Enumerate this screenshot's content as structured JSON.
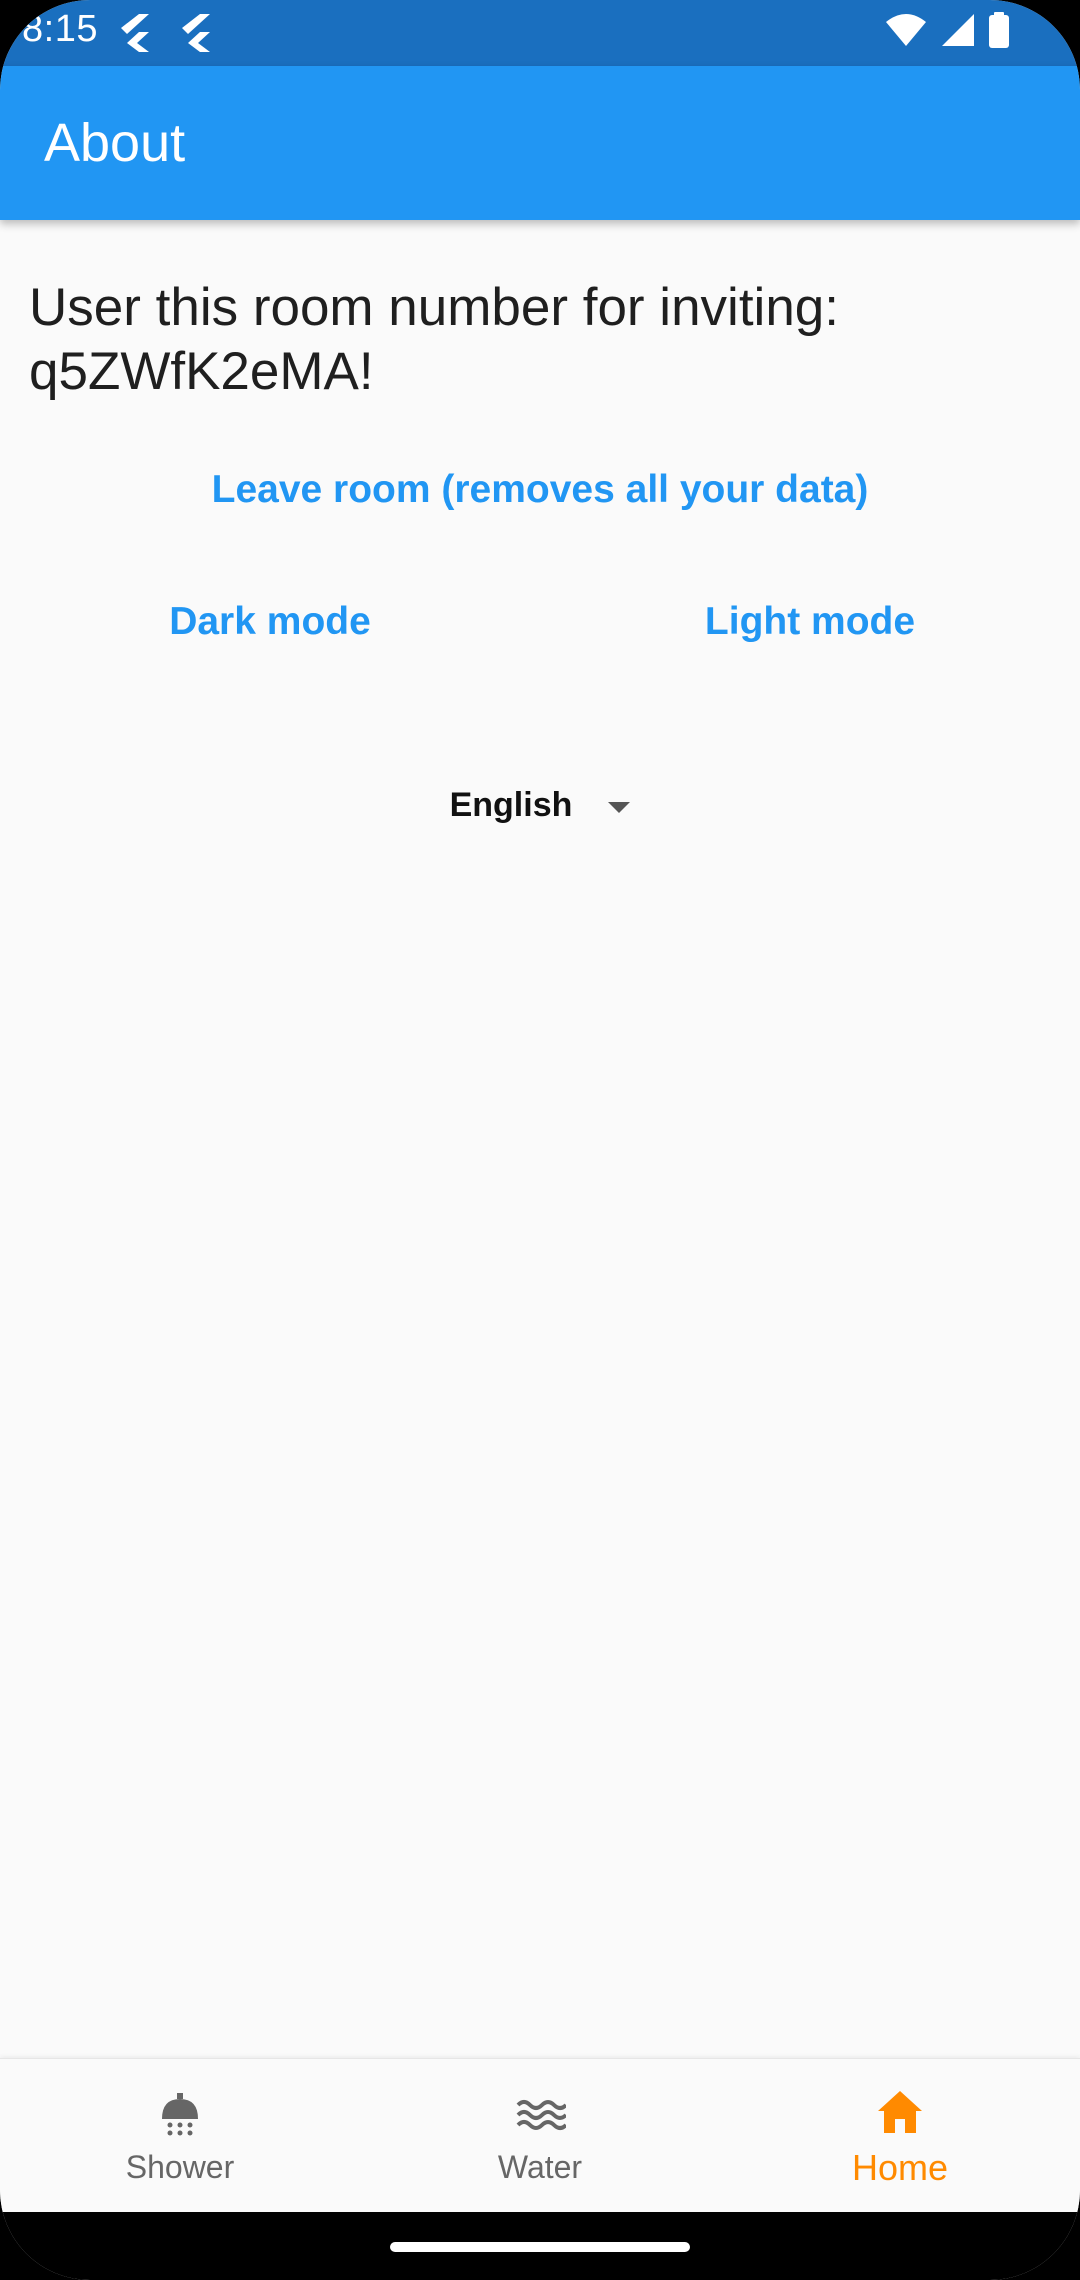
{
  "status_bar": {
    "time": "8:15"
  },
  "app_bar": {
    "title": "About"
  },
  "content": {
    "invite_line1": "User this room number for inviting:",
    "invite_line2": "q5ZWfK2eMA!",
    "leave_room_label": "Leave room (removes all your data)",
    "dark_mode_label": "Dark mode",
    "light_mode_label": "Light mode",
    "language_value": "English"
  },
  "bottom_nav": {
    "items": [
      {
        "label": "Shower",
        "icon": "shower-icon",
        "active": false
      },
      {
        "label": "Water",
        "icon": "waves-icon",
        "active": false
      },
      {
        "label": "Home",
        "icon": "home-icon",
        "active": true
      }
    ]
  },
  "colors": {
    "status_bar": "#1a6fbf",
    "app_bar": "#2196f3",
    "link": "#2196f3",
    "active_nav": "#ff8a00",
    "inactive_nav": "#666666",
    "background": "#fafafa"
  }
}
